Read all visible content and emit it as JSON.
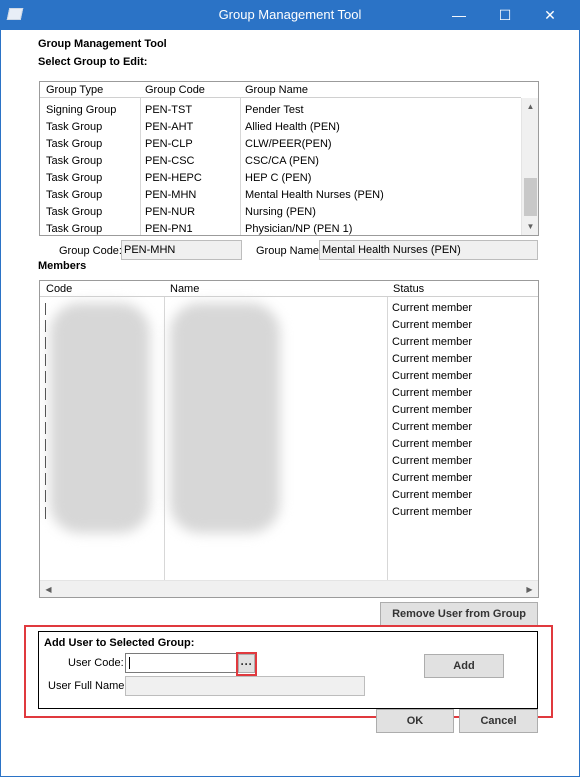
{
  "window": {
    "title": "Group Management Tool",
    "minimize_glyph": "—",
    "maximize_glyph": "☐",
    "close_glyph": "✕"
  },
  "header": {
    "heading": "Group Management Tool",
    "select_label": "Select Group to Edit:"
  },
  "groups_table": {
    "columns": [
      "Group Type",
      "Group Code",
      "Group Name"
    ],
    "rows": [
      [
        "Signing Group",
        "PEN-TST",
        "Pender Test"
      ],
      [
        "Task Group",
        "PEN-AHT",
        "Allied Health (PEN)"
      ],
      [
        "Task Group",
        "PEN-CLP",
        "CLW/PEER(PEN)"
      ],
      [
        "Task Group",
        "PEN-CSC",
        "CSC/CA (PEN)"
      ],
      [
        "Task Group",
        "PEN-HEPC",
        "HEP C (PEN)"
      ],
      [
        "Task Group",
        "PEN-MHN",
        "Mental Health Nurses (PEN)"
      ],
      [
        "Task Group",
        "PEN-NUR",
        "Nursing (PEN)"
      ],
      [
        "Task Group",
        "PEN-PN1",
        "Physician/NP (PEN 1)"
      ]
    ]
  },
  "selected_group": {
    "code_label": "Group Code:",
    "code_value": "PEN-MHN",
    "name_label": "Group Name:",
    "name_value": "Mental Health Nurses (PEN)"
  },
  "members": {
    "section_label": "Members",
    "columns": [
      "Code",
      "Name",
      "Status"
    ],
    "statuses": [
      "Current member",
      "Current member",
      "Current member",
      "Current member",
      "Current member",
      "Current member",
      "Current member",
      "Current member",
      "Current member",
      "Current member",
      "Current member",
      "Current member",
      "Current member"
    ],
    "remove_button": "Remove User from Group"
  },
  "add_user": {
    "section_label": "Add User to Selected Group:",
    "user_code_label": "User Code:",
    "user_code_value": "",
    "browse_button": "···",
    "user_full_name_label": "User Full Name:",
    "user_full_name_value": "",
    "add_button": "Add"
  },
  "footer": {
    "ok_button": "OK",
    "cancel_button": "Cancel"
  },
  "colors": {
    "titlebar": "#2b73c6",
    "highlight_red": "#e0393e"
  }
}
